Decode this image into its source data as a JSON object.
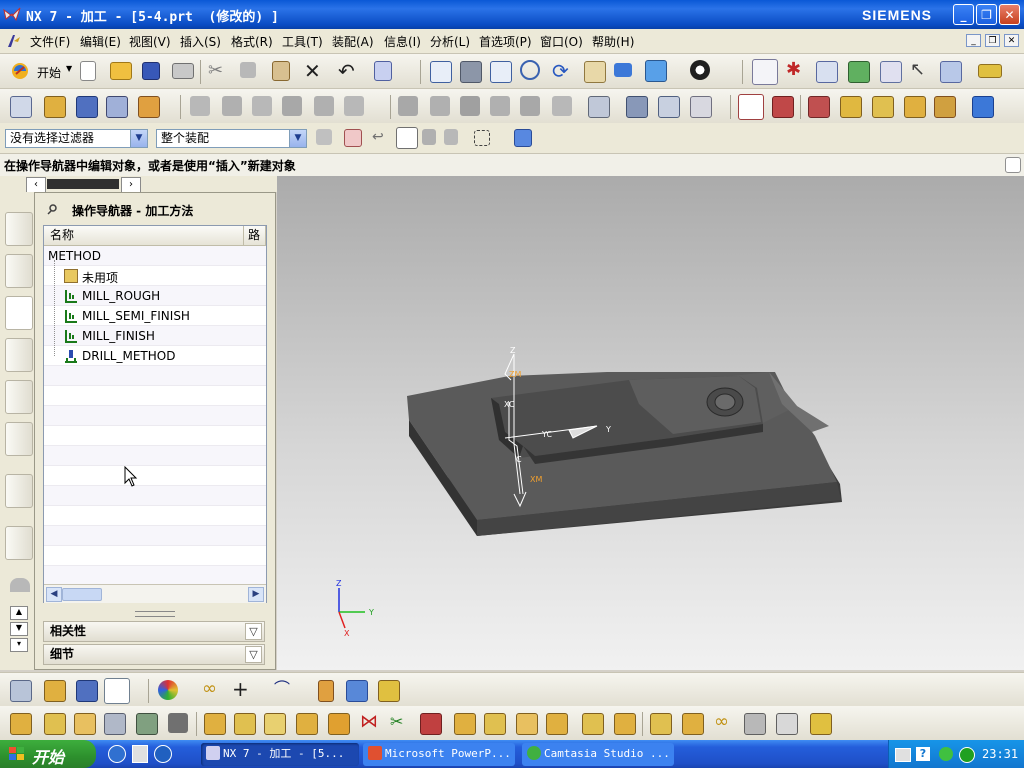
{
  "window": {
    "title": "NX 7 - 加工 - [5-4.prt  (修改的) ]",
    "brand": "SIEMENS"
  },
  "menu": [
    {
      "label": "文件(F)"
    },
    {
      "label": "编辑(E)"
    },
    {
      "label": "视图(V)"
    },
    {
      "label": "插入(S)"
    },
    {
      "label": "格式(R)"
    },
    {
      "label": "工具(T)"
    },
    {
      "label": "装配(A)"
    },
    {
      "label": "信息(I)"
    },
    {
      "label": "分析(L)"
    },
    {
      "label": "首选项(P)"
    },
    {
      "label": "窗口(O)"
    },
    {
      "label": "帮助(H)"
    }
  ],
  "toolbar": {
    "start_label": "开始"
  },
  "selection": {
    "filter_value": "没有选择过滤器",
    "scope_value": "整个装配"
  },
  "cue_line": "在操作导航器中编辑对象，或者是使用“插入”新建对象",
  "navigator": {
    "title": "操作导航器 - 加工方法",
    "columns": {
      "name": "名称",
      "path": "路"
    },
    "rows": [
      {
        "label": "METHOD",
        "icon": "none"
      },
      {
        "label": "未用项",
        "icon": "folder-icon"
      },
      {
        "label": "MILL_ROUGH",
        "icon": "mill-method-icon"
      },
      {
        "label": "MILL_SEMI_FINISH",
        "icon": "mill-method-icon"
      },
      {
        "label": "MILL_FINISH",
        "icon": "mill-method-icon"
      },
      {
        "label": "DRILL_METHOD",
        "icon": "drill-method-icon"
      }
    ],
    "subpanels": {
      "dependencies": "相关性",
      "details": "细节"
    }
  },
  "viewport": {
    "wcs_labels": {
      "z": "Z",
      "zm": "ZM",
      "xc": "XC",
      "yc": "YC",
      "y": "Y",
      "c": "C",
      "xm": "XM"
    },
    "triad_labels": {
      "z": "Z",
      "y": "Y",
      "x": "X"
    }
  },
  "taskbar": {
    "start_label": "开始",
    "tasks": [
      {
        "label": "NX 7 - 加工 - [5...",
        "active": true
      },
      {
        "label": "Microsoft PowerP...",
        "active": false
      },
      {
        "label": "Camtasia Studio ...",
        "active": false
      }
    ],
    "clock": "23:31"
  },
  "colors": {
    "title_bar": "#0a58d6",
    "taskbar": "#245edb",
    "start_button": "#2d902d",
    "model_top": "#5d5d5d",
    "model_side": "#3a3a3a",
    "wcs_axes": "#ffffff",
    "triad_x": "#e02020",
    "triad_y": "#20c020",
    "triad_z": "#2030e0"
  }
}
